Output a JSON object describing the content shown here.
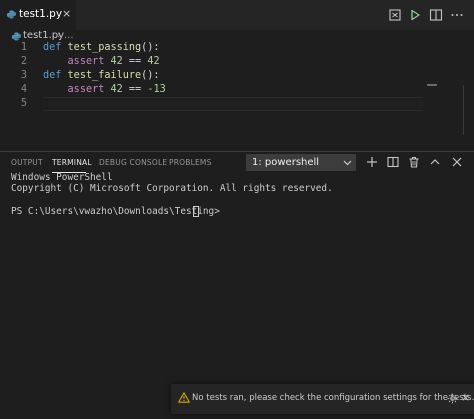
{
  "editor_tabs": [
    {
      "label": "test1.py",
      "icon": "python-file-icon",
      "close_glyph": "×"
    }
  ],
  "toolbar_icons": [
    "compare-changes-icon",
    "run-icon",
    "split-editor-icon",
    "more-actions-icon"
  ],
  "breadcrumb": {
    "file": "test1.py",
    "separator": "›",
    "more": "..."
  },
  "code_lines": [
    {
      "num": "1",
      "tokens": [
        [
          "kw",
          "def "
        ],
        [
          "fn",
          "test_passing"
        ],
        [
          "txt",
          "():"
        ]
      ]
    },
    {
      "num": "2",
      "tokens": [
        [
          "txt",
          "    "
        ],
        [
          "ctl",
          "assert"
        ],
        [
          "txt",
          " "
        ],
        [
          "num",
          "42"
        ],
        [
          "txt",
          " == "
        ],
        [
          "num",
          "42"
        ]
      ]
    },
    {
      "num": "3",
      "tokens": [
        [
          "kw",
          "def "
        ],
        [
          "fn",
          "test_failure"
        ],
        [
          "txt",
          "():"
        ]
      ]
    },
    {
      "num": "4",
      "tokens": [
        [
          "txt",
          "    "
        ],
        [
          "ctl",
          "assert"
        ],
        [
          "txt",
          " "
        ],
        [
          "num",
          "42"
        ],
        [
          "txt",
          " == "
        ],
        [
          "num",
          "-13"
        ]
      ]
    },
    {
      "num": "5",
      "tokens": []
    }
  ],
  "panel": {
    "tabs": [
      "OUTPUT",
      "TERMINAL",
      "DEBUG CONSOLE",
      "PROBLEMS"
    ],
    "active_tab": "TERMINAL",
    "terminal_select": "1: powershell",
    "icons": [
      "new-terminal-icon",
      "split-terminal-icon",
      "kill-terminal-icon",
      "maximize-panel-icon",
      "close-panel-icon"
    ]
  },
  "terminal": {
    "line1": "Windows PowerShell",
    "line2": "Copyright (C) Microsoft Corporation. All rights reserved.",
    "prompt": "PS C:\\Users\\vwazho\\Downloads\\Testing> "
  },
  "notification": {
    "icon": "warning-icon",
    "message": "No tests ran, please check the configuration settings for the tests.",
    "close_glyph": "×"
  },
  "colors": {
    "editor_bg": "#1e1e1e",
    "keyword": "#569cd6",
    "function": "#dcdcaa",
    "control": "#c586c0",
    "number": "#b5cea8",
    "run_green": "#89d185",
    "warning": "#cca700"
  }
}
